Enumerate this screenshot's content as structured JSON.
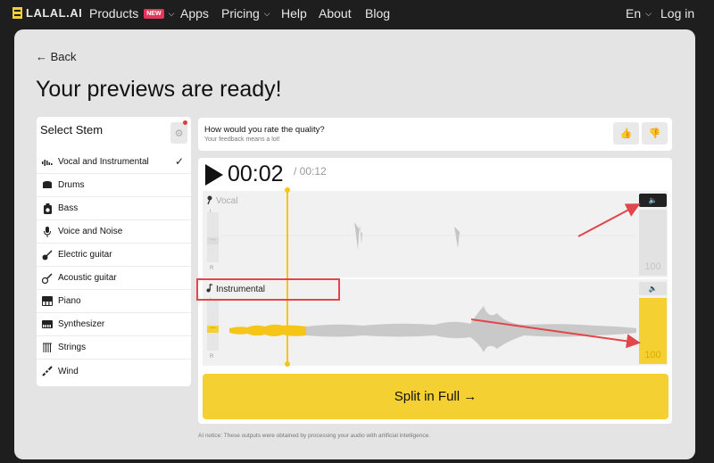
{
  "nav": {
    "logo": "LALAL.AI",
    "products": "Products",
    "new_badge": "NEW",
    "apps": "Apps",
    "pricing": "Pricing",
    "help": "Help",
    "about": "About",
    "blog": "Blog",
    "lang": "En",
    "login": "Log in"
  },
  "page": {
    "back": "← Back",
    "title": "Your previews are ready!"
  },
  "stems": {
    "heading": "Select Stem",
    "items": [
      {
        "label": "Vocal and Instrumental",
        "icon": "vocal-instrumental-icon",
        "selected": true
      },
      {
        "label": "Drums",
        "icon": "drums-icon"
      },
      {
        "label": "Bass",
        "icon": "bass-icon"
      },
      {
        "label": "Voice and Noise",
        "icon": "voice-noise-icon"
      },
      {
        "label": "Electric guitar",
        "icon": "electric-guitar-icon"
      },
      {
        "label": "Acoustic guitar",
        "icon": "acoustic-guitar-icon"
      },
      {
        "label": "Piano",
        "icon": "piano-icon"
      },
      {
        "label": "Synthesizer",
        "icon": "synthesizer-icon"
      },
      {
        "label": "Strings",
        "icon": "strings-icon"
      },
      {
        "label": "Wind",
        "icon": "wind-icon"
      }
    ]
  },
  "rating": {
    "question": "How would you rate the quality?",
    "sub": "Your feedback means a lot!"
  },
  "player": {
    "current_time": "00:02",
    "total_time": "/ 00:12",
    "tracks": [
      {
        "label": "Vocal",
        "volume": "100",
        "muted": true
      },
      {
        "label": "Instrumental",
        "volume": "100",
        "muted": false
      }
    ],
    "channel_l": "L",
    "channel_r": "R",
    "split_label": "Split in Full →"
  },
  "notice": "AI notice: These outputs were obtained by processing your audio with artificial intelligence.",
  "colors": {
    "accent": "#f5d033",
    "annotation": "#e0464a"
  }
}
